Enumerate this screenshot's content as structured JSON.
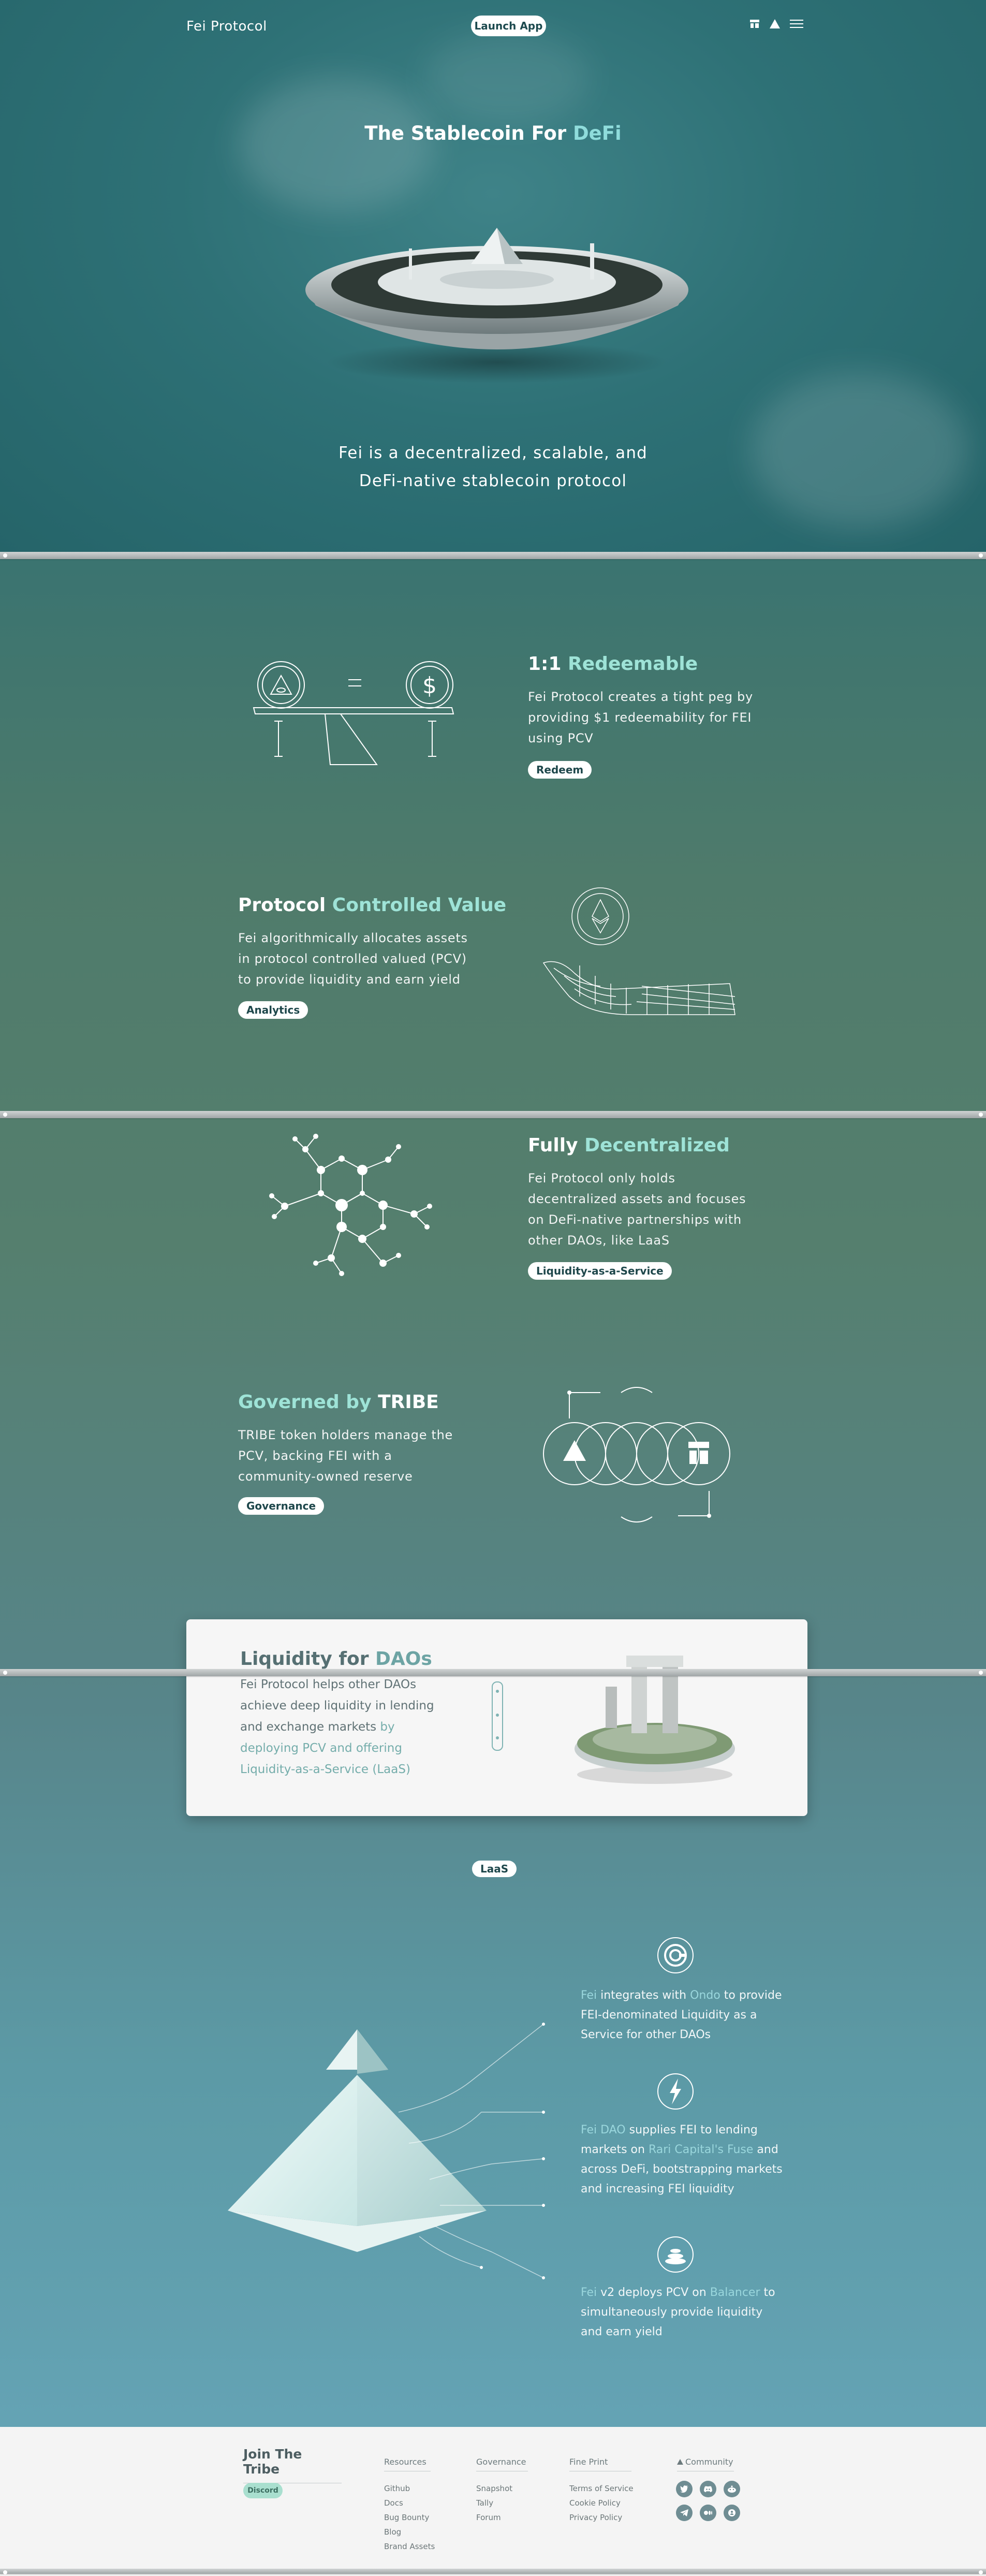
{
  "nav": {
    "brand": "Fei Protocol",
    "launch_label": "Launch App",
    "icons": [
      "tribe-icon",
      "fei-icon",
      "menu-icon"
    ]
  },
  "hero": {
    "title_plain": "The Stablecoin For",
    "title_accent": "DeFi",
    "subtitle_line1": "Fei is a decentralized, scalable, and",
    "subtitle_line2": "DeFi-native stablecoin protocol"
  },
  "features": {
    "redeemable": {
      "title_plain": "1:1",
      "title_accent": "Redeemable",
      "body": "Fei Protocol creates a tight peg by providing $1 redeemability for FEI using PCV",
      "button": "Redeem"
    },
    "pcv": {
      "title_plain": "Protocol",
      "title_accent": "Controlled Value",
      "body": "Fei algorithmically allocates assets in protocol controlled valued (PCV) to provide liquidity and earn yield",
      "button": "Analytics"
    },
    "decentralized": {
      "title_plain": "Fully",
      "title_accent": "Decentralized",
      "body": "Fei Protocol only holds decentralized assets and focuses on DeFi-native partnerships with other DAOs, like LaaS",
      "button": "Liquidity-as-a-Service"
    },
    "governed": {
      "title_accent": "Governed by",
      "title_plain": "TRIBE",
      "body": "TRIBE token holders manage the PCV, backing FEI with a community-owned reserve",
      "button": "Governance"
    }
  },
  "liquidity_card": {
    "title_plain": "Liquidity for",
    "title_accent": "DAOs",
    "body_plain": "Fei Protocol helps other DAOs achieve deep liquidity in lending and exchange markets",
    "body_accent": "by deploying PCV and offering Liquidity-as-a-Service (LaaS)"
  },
  "laas": {
    "badge": "LaaS",
    "items": [
      {
        "icon": "ondo-icon",
        "segments": [
          "Fei",
          " integrates with ",
          "Ondo",
          " to provide FEI-denominated Liquidity as a Service for other DAOs"
        ]
      },
      {
        "icon": "lightning-icon",
        "segments": [
          "Fei DAO",
          " supplies FEI to lending markets on ",
          "Rari Capital's Fuse",
          " and across DeFi, bootstrapping markets and increasing FEI liquidity"
        ]
      },
      {
        "icon": "balancer-icon",
        "segments": [
          "Fei",
          " v2 deploys PCV on ",
          "Balancer",
          " to simultaneously provide liquidity and earn yield"
        ]
      }
    ]
  },
  "footer": {
    "join_title": "Join The Tribe",
    "discord_button": "Discord",
    "resources": {
      "title": "Resources",
      "links": [
        "Github",
        "Docs",
        "Bug Bounty",
        "Blog",
        "Brand Assets"
      ]
    },
    "governance": {
      "title": "Governance",
      "links": [
        "Snapshot",
        "Tally",
        "Forum"
      ]
    },
    "fine_print": {
      "title": "Fine Print",
      "links": [
        "Terms of Service",
        "Cookie Policy",
        "Privacy Policy"
      ]
    },
    "community": {
      "title": "Community",
      "icons": [
        "twitter-icon",
        "discord-icon",
        "reddit-icon",
        "telegram-icon",
        "medium-icon",
        "github-icon"
      ]
    }
  },
  "colors": {
    "accent": "#8fdcdb",
    "hero_bg": "#2b6a70",
    "footer_bg": "#f4f4f4"
  }
}
